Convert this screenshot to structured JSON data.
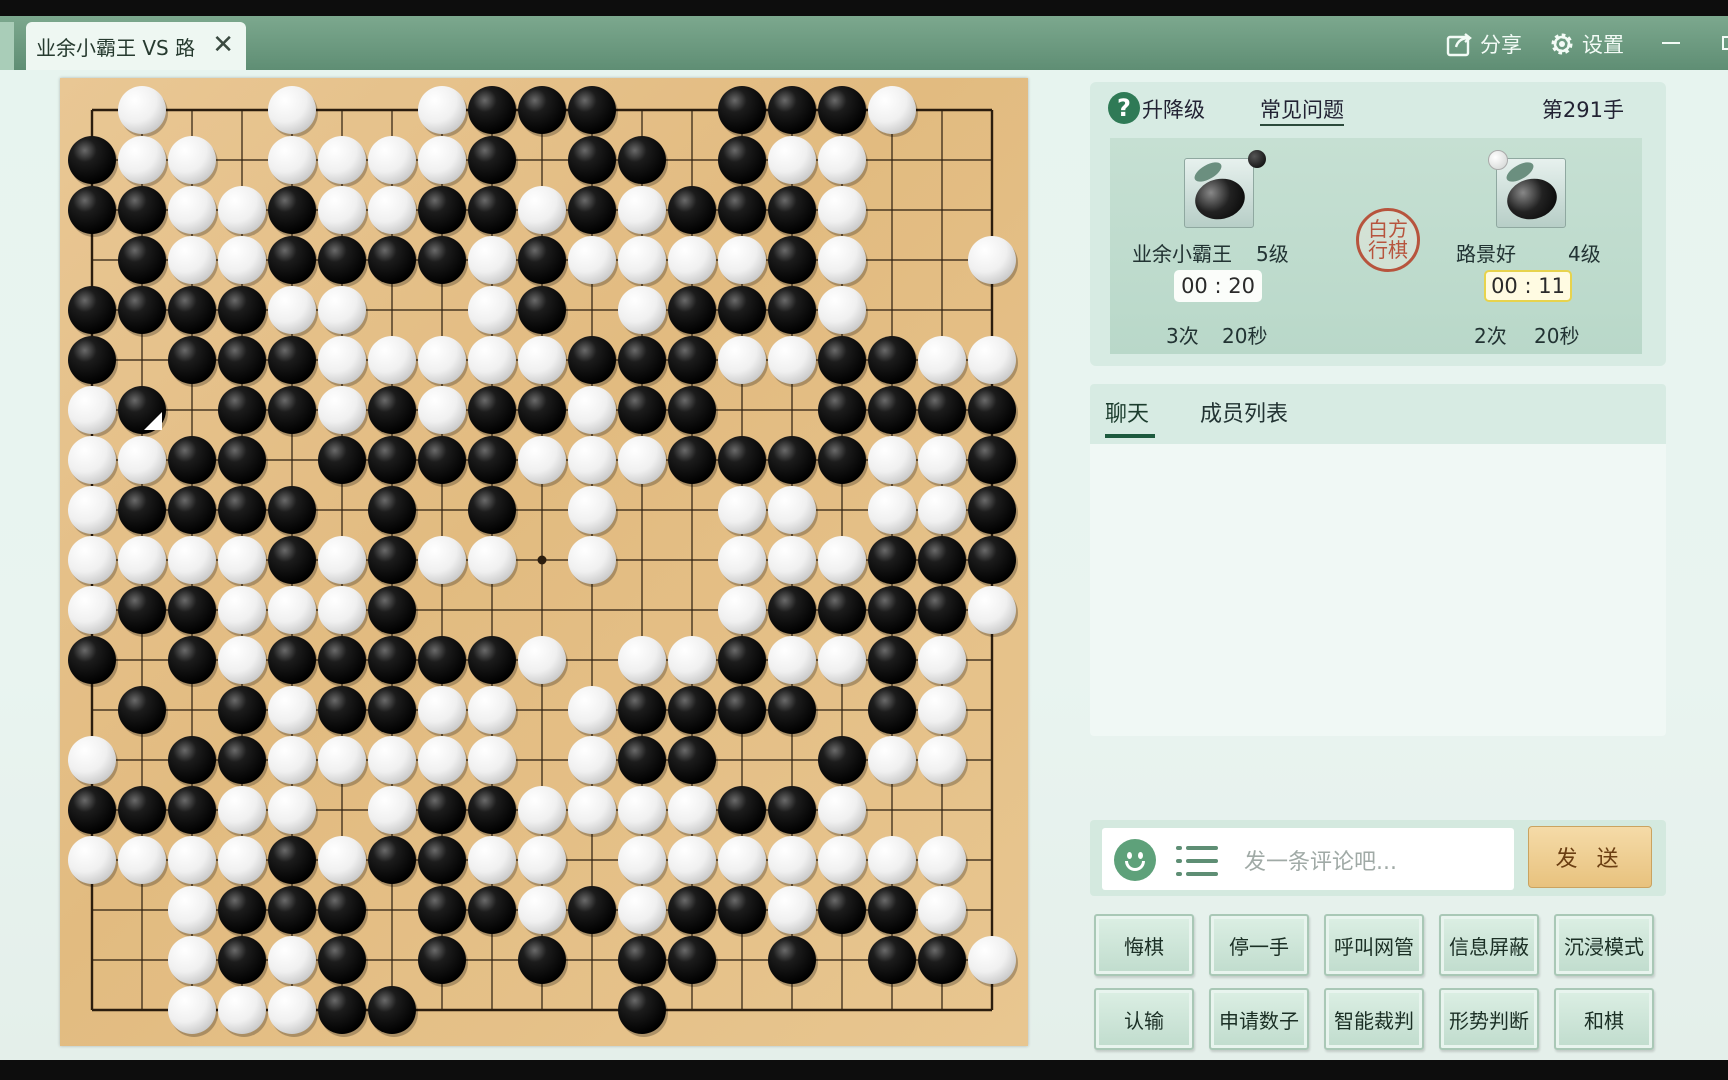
{
  "window": {
    "tab_title": "业余小霸王 VS 路",
    "share_label": "分享",
    "settings_label": "设置"
  },
  "info": {
    "upgrade_label": "升降级",
    "faq_label": "常见问题",
    "move_number": "第291手",
    "turn_text_line1": "白方",
    "turn_text_line2": "行棋"
  },
  "players": {
    "black": {
      "name": "业余小霸王",
      "rank": "5级",
      "time": "00 : 20",
      "periods": "3次",
      "byo_seconds": "20秒",
      "stone": "black"
    },
    "white": {
      "name": "路景好",
      "rank": "4级",
      "time": "00 : 11",
      "periods": "2次",
      "byo_seconds": "20秒",
      "stone": "white"
    }
  },
  "chat": {
    "tab_chat": "聊天",
    "tab_members": "成员列表",
    "placeholder": "发一条评论吧...",
    "send_label": "发 送"
  },
  "actions": [
    {
      "label": "悔棋",
      "name": "undo-button"
    },
    {
      "label": "停一手",
      "name": "pass-button"
    },
    {
      "label": "呼叫网管",
      "name": "call-admin-button"
    },
    {
      "label": "信息屏蔽",
      "name": "block-info-button"
    },
    {
      "label": "沉浸模式",
      "name": "immersive-mode-button"
    },
    {
      "label": "认输",
      "name": "resign-button"
    },
    {
      "label": "申请数子",
      "name": "request-count-button"
    },
    {
      "label": "智能裁判",
      "name": "ai-referee-button"
    },
    {
      "label": "形势判断",
      "name": "position-eval-button"
    },
    {
      "label": "和棋",
      "name": "draw-button"
    }
  ],
  "colors": {
    "board": "#e6c28a",
    "board_lines": "#2b1d0e",
    "accent": "#1d5a3e",
    "title_bar": "#6b9a80"
  },
  "board": {
    "size": 19,
    "last_move": [
      1,
      6
    ],
    "rows": [
      "-W--W--WBBB--BBBW--",
      "BWW-WWWWB-BB-BWW---",
      "BBWWBWWBBWBWBBBW---",
      "-BWWBBBBWBWWWWBW--W",
      "BBBBWW--WB-WBBBW---",
      "B-BBBWWWWWBBBWWBBWW",
      "WB-BBWBWBBWBB--BBBB",
      "WWBB-BBBBWWWBBBBWWB",
      "WBBBB-B-B-W--WW-WWB-",
      "WWWWBWBWW-W--WWWBBB",
      "WBBWWWB------WBBBBW",
      "B-BWBBBBBW-WWBWWBW-",
      "-B-BWBBWW-WBBBB-BW-",
      "W-BBWWWWW-WBB--BWW-",
      "BBBWW-WBBWWWWBBW---",
      "WWWWBWBBWW-WWWWWWW-",
      "--WBBB-BBWBWBBWBBW-",
      "--WBWB-B-B-BB-B-BBW",
      "--WWWBB----B-------"
    ]
  }
}
